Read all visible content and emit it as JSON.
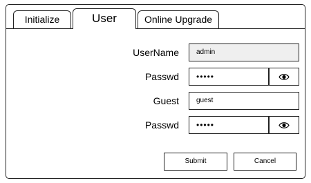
{
  "tabs": [
    {
      "label": "Initialize",
      "active": false
    },
    {
      "label": "User",
      "active": true
    },
    {
      "label": "Online Upgrade",
      "active": false
    }
  ],
  "form": {
    "username_label": "UserName",
    "username_value": "admin",
    "user_passwd_label": "Passwd",
    "user_passwd_value": "•••••",
    "guest_label": "Guest",
    "guest_value": "guest",
    "guest_passwd_label": "Passwd",
    "guest_passwd_value": "•••••"
  },
  "buttons": {
    "submit": "Submit",
    "cancel": "Cancel"
  },
  "icons": {
    "show_password": "eye-icon"
  }
}
